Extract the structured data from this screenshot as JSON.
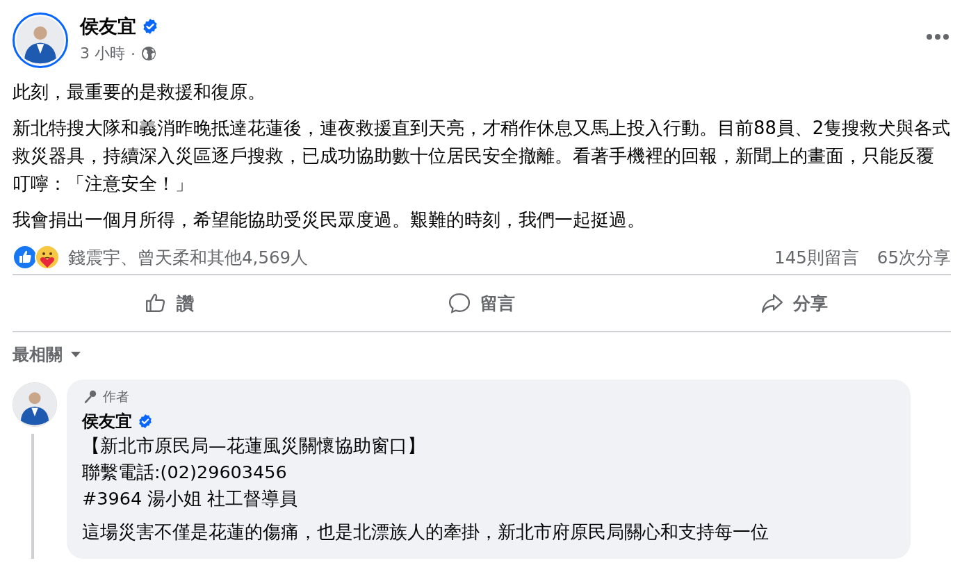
{
  "post": {
    "author": "侯友宜",
    "verified": true,
    "time": "3 小時",
    "separator": "·",
    "paragraphs": [
      "此刻，最重要的是救援和復原。",
      "新北特搜大隊和義消昨晚抵達花蓮後，連夜救援直到天亮，才稍作休息又馬上投入行動。目前88員、2隻搜救犬與各式救災器具，持續深入災區逐戶搜救，已成功協助數十位居民安全撤離。看著手機裡的回報，新聞上的畫面，只能反覆叮嚀：「注意安全！」",
      "我會捐出一個月所得，希望能協助受災民眾度過。艱難的時刻，我們一起挺過。"
    ]
  },
  "reactions": {
    "summary": "錢震宇、曾天柔和其他4,569人",
    "comments": "145則留言",
    "shares": "65次分享"
  },
  "actions": [
    {
      "kind": "like",
      "label": "讚"
    },
    {
      "kind": "comment",
      "label": "留言"
    },
    {
      "kind": "share",
      "label": "分享"
    }
  ],
  "sort": {
    "label": "最相關"
  },
  "comment": {
    "badge": "作者",
    "author": "侯友宜",
    "verified": true,
    "lines": [
      "【新北市原民局—花蓮風災關懷協助窗口】",
      "聯繫電話:(02)29603456",
      "#3964 湯小姐 社工督導員"
    ],
    "paragraph": "這場災害不僅是花蓮的傷痛，也是北漂族人的牽掛，新北市府原民局關心和支持每一位"
  }
}
